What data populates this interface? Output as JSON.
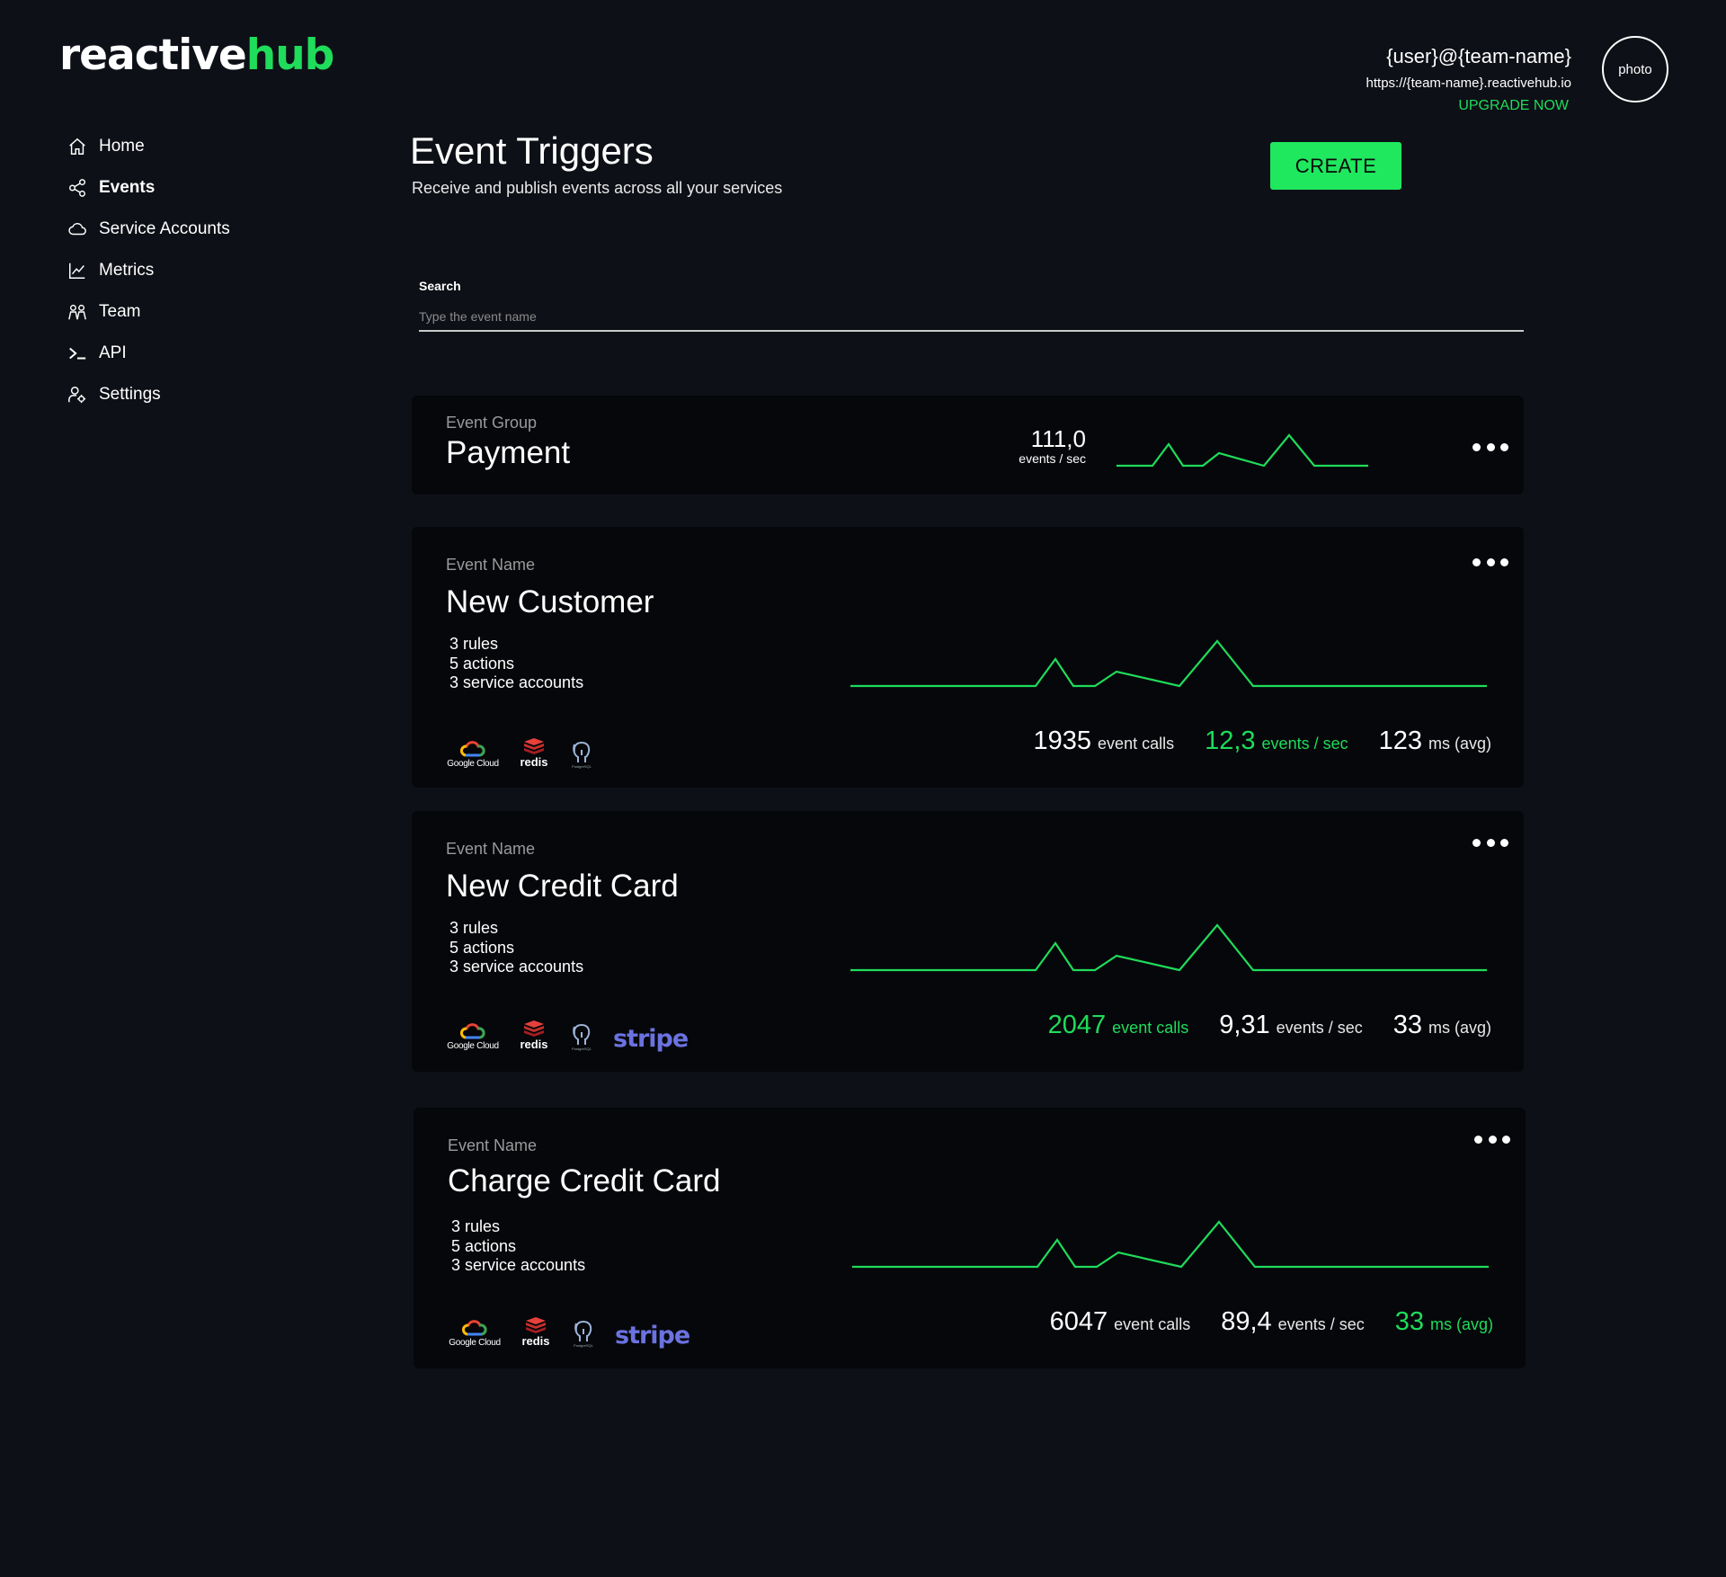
{
  "logo": {
    "part1": "reactive",
    "part2": "hub"
  },
  "profile": {
    "user": "{user}@{team-name}",
    "url": "https://{team-name}.reactivehub.io",
    "upgrade": "UPGRADE NOW",
    "avatar": "photo"
  },
  "nav": {
    "items": [
      {
        "label": "Home",
        "icon": "home-icon"
      },
      {
        "label": "Events",
        "icon": "share-icon",
        "active": true
      },
      {
        "label": "Service Accounts",
        "icon": "cloud-icon"
      },
      {
        "label": "Metrics",
        "icon": "chart-line-icon"
      },
      {
        "label": "Team",
        "icon": "team-icon"
      },
      {
        "label": "API",
        "icon": "terminal-icon"
      },
      {
        "label": "Settings",
        "icon": "user-settings-icon"
      }
    ]
  },
  "page": {
    "title": "Event Triggers",
    "subtitle": "Receive and publish events across all your services",
    "create": "CREATE"
  },
  "search": {
    "label": "Search",
    "placeholder": "Type the event name"
  },
  "group": {
    "label": "Event Group",
    "name": "Payment",
    "rate": "111,0",
    "rate_unit": "events / sec"
  },
  "events": [
    {
      "label": "Event Name",
      "name": "New Customer",
      "rules": "3 rules",
      "actions": "5 actions",
      "accounts": "3 service accounts",
      "logos": {
        "google": "Google Cloud",
        "redis": "redis",
        "postgres": "PostgreSQL",
        "stripe": ""
      },
      "calls": "1935",
      "calls_unit": "event calls",
      "rate": "12,3",
      "rate_unit": "events / sec",
      "latency": "123",
      "latency_unit": "ms (avg)",
      "highlight": "rate"
    },
    {
      "label": "Event Name",
      "name": "New Credit Card",
      "rules": "3 rules",
      "actions": "5 actions",
      "accounts": "3 service accounts",
      "logos": {
        "google": "Google Cloud",
        "redis": "redis",
        "postgres": "PostgreSQL",
        "stripe": "stripe"
      },
      "calls": "2047",
      "calls_unit": "event calls",
      "rate": "9,31",
      "rate_unit": "events / sec",
      "latency": "33",
      "latency_unit": "ms (avg)",
      "highlight": "calls"
    },
    {
      "label": "Event Name",
      "name": "Charge Credit Card",
      "rules": "3 rules",
      "actions": "5 actions",
      "accounts": "3 service accounts",
      "logos": {
        "google": "Google Cloud",
        "redis": "redis",
        "postgres": "PostgreSQL",
        "stripe": "stripe"
      },
      "calls": "6047",
      "calls_unit": "event calls",
      "rate": "89,4",
      "rate_unit": "events / sec",
      "latency": "33",
      "latency_unit": "ms (avg)",
      "highlight": "latency"
    }
  ],
  "colors": {
    "accent": "#1fdc5a",
    "button": "#1fe85e",
    "background": "#0e1017",
    "card": "#06070b",
    "stripe": "#6b72e0"
  }
}
